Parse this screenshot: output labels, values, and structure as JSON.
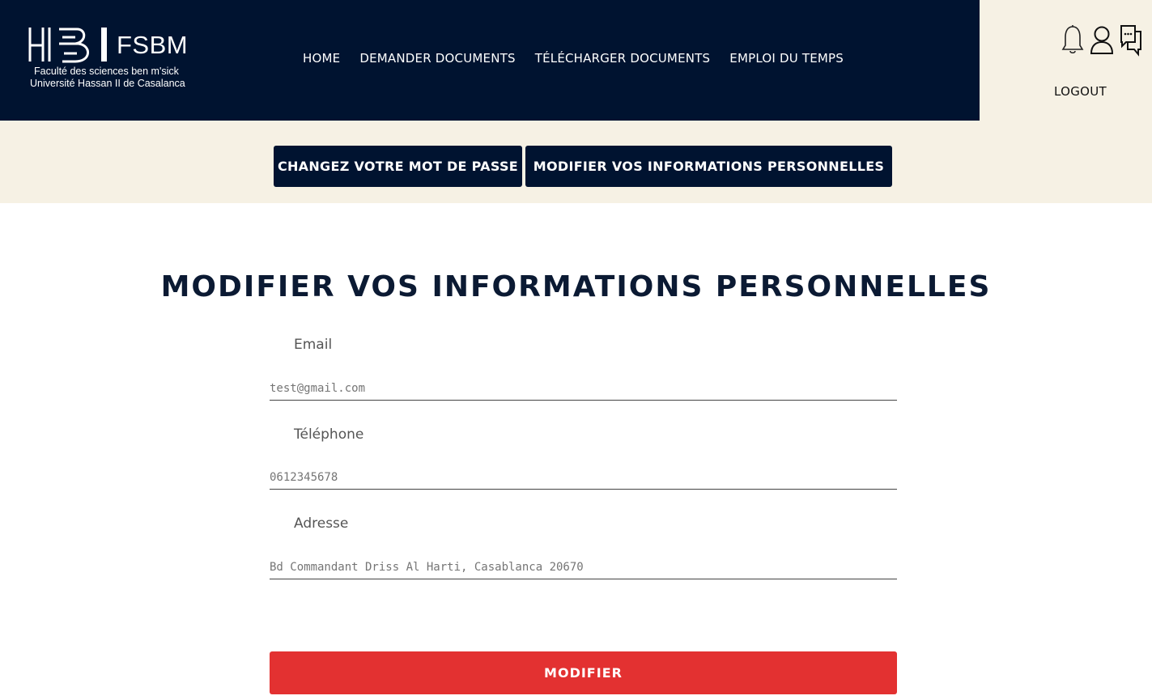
{
  "brand": {
    "acronym": "FSBM",
    "line1": "Faculté des sciences ben m'sick",
    "line2": "Université Hassan II de Casalanca"
  },
  "nav": {
    "items": [
      "HOME",
      "DEMANDER DOCUMENTS",
      "TÉLÉCHARGER DOCUMENTS",
      "EMPLOI DU TEMPS"
    ]
  },
  "user": {
    "icons": [
      "bell-icon",
      "user-icon",
      "chat-icon"
    ],
    "logout": "LOGOUT"
  },
  "tabs": {
    "password": "CHANGEZ VOTRE MOT DE PASSE",
    "info": "MODIFIER VOS INFORMATIONS PERSONNELLES"
  },
  "form": {
    "title": "MODIFIER VOS INFORMATIONS PERSONNELLES",
    "email_label": "Email",
    "email_placeholder": "test@gmail.com",
    "phone_label": "Téléphone",
    "phone_placeholder": "0612345678",
    "address_label": "Adresse",
    "address_placeholder": "Bd Commandant Driss Al Harti, Casablanca 20670",
    "submit": "MODIFIER"
  },
  "colors": {
    "navy": "#001330",
    "cream": "#f6f1e4",
    "accent_red": "#e33131"
  }
}
